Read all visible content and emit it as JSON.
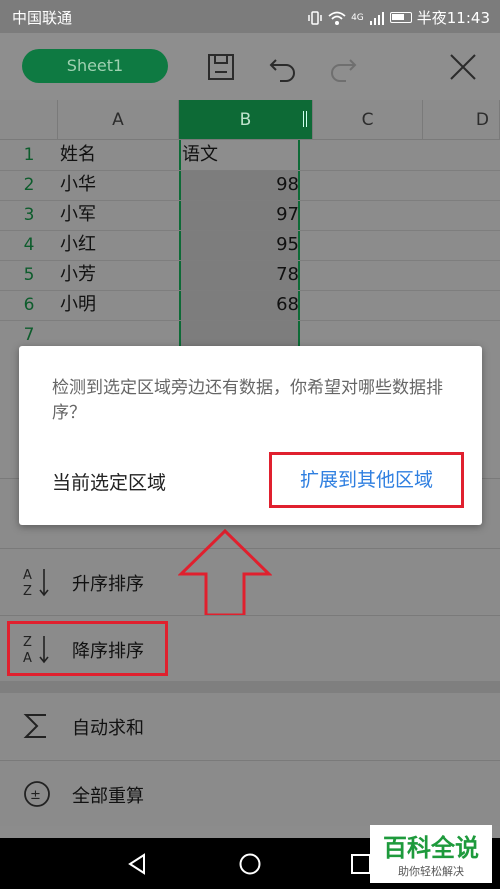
{
  "status": {
    "carrier": "中国联通",
    "time": "半夜11:43",
    "net": "4G"
  },
  "toolbar": {
    "sheet_tab": "Sheet1"
  },
  "columns": [
    "A",
    "B",
    "C",
    "D"
  ],
  "rows": [
    "1",
    "2",
    "3",
    "4",
    "5",
    "6",
    "7"
  ],
  "table": {
    "header": {
      "name": "姓名",
      "score": "语文"
    },
    "data": [
      {
        "name": "小华",
        "score": "98"
      },
      {
        "name": "小军",
        "score": "97"
      },
      {
        "name": "小红",
        "score": "95"
      },
      {
        "name": "小芳",
        "score": "78"
      },
      {
        "name": "小明",
        "score": "68"
      }
    ]
  },
  "dialog": {
    "message": "检测到选定区域旁边还有数据，你希望对哪些数据排序？",
    "btn_current": "当前选定区域",
    "btn_expand": "扩展到其他区域"
  },
  "menu": {
    "asc": "升序排序",
    "desc": "降序排序",
    "autosum": "自动求和",
    "recalc": "全部重算"
  },
  "watermark": {
    "title": "百科全说",
    "subtitle": "助你轻松解决"
  },
  "colors": {
    "accent": "#0e7a42",
    "highlight": "#e0202e",
    "link": "#2f7fe0"
  }
}
